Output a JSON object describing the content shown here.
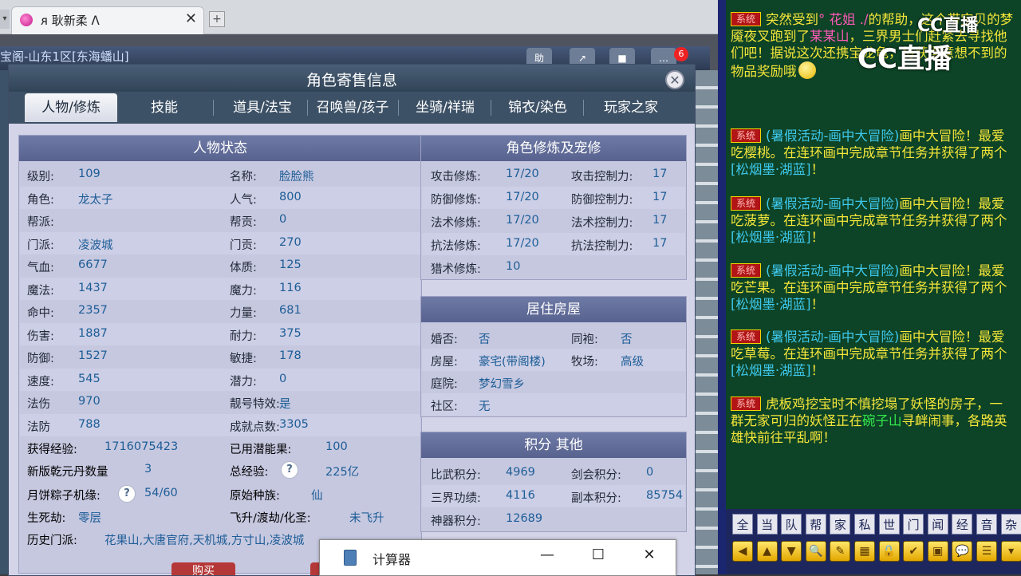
{
  "browser": {
    "tab_title": "ᴙ 耿新柔 ᐱ",
    "new_tab_label": "+",
    "tab_close": "✕",
    "scroll_label": "▾",
    "location": "宝阁-山东1区[东海蟠山]",
    "toolbar": [
      "助",
      "↗",
      "■",
      "…"
    ],
    "badge_count": "6"
  },
  "dialog": {
    "title": "角色寄售信息",
    "close": "✕",
    "tabs": [
      "人物/修炼",
      "技能",
      "道具/法宝",
      "召唤兽/孩子",
      "坐骑/祥瑞",
      "锦衣/染色",
      "玩家之家"
    ],
    "active_tab": 0,
    "status": {
      "heading": "人物状态",
      "rows": [
        [
          {
            "l": "级别:",
            "v": "109"
          },
          {
            "l": "名称:",
            "v": "脸脸熊"
          }
        ],
        [
          {
            "l": "角色:",
            "v": "龙太子"
          },
          {
            "l": "人气:",
            "v": "800"
          }
        ],
        [
          {
            "l": "帮派:",
            "v": ""
          },
          {
            "l": "帮贡:",
            "v": "0"
          }
        ],
        [
          {
            "l": "门派:",
            "v": "凌波城"
          },
          {
            "l": "门贡:",
            "v": "270"
          }
        ],
        [
          {
            "l": "气血:",
            "v": "6677"
          },
          {
            "l": "体质:",
            "v": "125"
          }
        ],
        [
          {
            "l": "魔法:",
            "v": "1437"
          },
          {
            "l": "魔力:",
            "v": "116"
          }
        ],
        [
          {
            "l": "命中:",
            "v": "2357"
          },
          {
            "l": "力量:",
            "v": "681"
          }
        ],
        [
          {
            "l": "伤害:",
            "v": "1887"
          },
          {
            "l": "耐力:",
            "v": "375"
          }
        ],
        [
          {
            "l": "防御:",
            "v": "1527"
          },
          {
            "l": "敏捷:",
            "v": "178"
          }
        ],
        [
          {
            "l": "速度:",
            "v": "545"
          },
          {
            "l": "潜力:",
            "v": "0"
          }
        ],
        [
          {
            "l": "法伤",
            "v": "970"
          },
          {
            "l": "靓号特效:",
            "v": "是"
          }
        ],
        [
          {
            "l": "法防",
            "v": "788"
          },
          {
            "l": "成就点数:",
            "v": "3305"
          }
        ]
      ],
      "exp_label": "获得经验:",
      "exp_value": "1716075423",
      "used_fruit_label": "已用潜能果:",
      "used_fruit_value": "100",
      "qiankun_label": "新版乾元丹数量",
      "qiankun_value": "3",
      "total_exp_label": "总经验:",
      "total_exp_value": "225亿",
      "zongzi_label": "月饼粽子机缘:",
      "zongzi_value": "54/60",
      "race_label": "原始种族:",
      "race_value": "仙",
      "life_label": "生死劫:",
      "life_value": "零层",
      "ascend_label": "飞升/渡劫/化圣:",
      "ascend_value": "未飞升",
      "history_label": "历史门派:",
      "history_value": "花果山,大唐官府,天机城,方寸山,凌波城",
      "help": "?"
    },
    "cultivation": {
      "heading": "角色修炼及宠修",
      "rows": [
        [
          {
            "l": "攻击修炼:",
            "v": "17/20"
          },
          {
            "l": "攻击控制力:",
            "v": "17"
          }
        ],
        [
          {
            "l": "防御修炼:",
            "v": "17/20"
          },
          {
            "l": "防御控制力:",
            "v": "17"
          }
        ],
        [
          {
            "l": "法术修炼:",
            "v": "17/20"
          },
          {
            "l": "法术控制力:",
            "v": "17"
          }
        ],
        [
          {
            "l": "抗法修炼:",
            "v": "17/20"
          },
          {
            "l": "抗法控制力:",
            "v": "17"
          }
        ],
        [
          {
            "l": "猎术修炼:",
            "v": "10"
          }
        ]
      ]
    },
    "house": {
      "heading": "居住房屋",
      "rows": [
        [
          {
            "l": "婚否:",
            "v": "否"
          },
          {
            "l": "同袍:",
            "v": "否"
          }
        ],
        [
          {
            "l": "房屋:",
            "v": "豪宅(带阁楼)"
          },
          {
            "l": "牧场:",
            "v": "高级"
          }
        ],
        [
          {
            "l": "庭院:",
            "v": "梦幻雪乡"
          }
        ],
        [
          {
            "l": "社区:",
            "v": "无"
          }
        ]
      ]
    },
    "points": {
      "heading": "积分 其他",
      "rows": [
        [
          {
            "l": "比武积分:",
            "v": "4969"
          },
          {
            "l": "剑会积分:",
            "v": "0"
          }
        ],
        [
          {
            "l": "三界功绩:",
            "v": "4116"
          },
          {
            "l": "副本积分:",
            "v": "85754"
          }
        ],
        [
          {
            "l": "神器积分:",
            "v": "12689"
          }
        ]
      ]
    },
    "buy_label": "购买"
  },
  "calculator": {
    "title": "计算器",
    "min": "—",
    "max": "☐",
    "close": "✕"
  },
  "chat": {
    "sys_tag": "系统",
    "logo": "CC直播",
    "messages": [
      {
        "parts": [
          {
            "c": "yellow",
            "t": "突然受到"
          },
          {
            "c": "pink",
            "t": "° 花姐 ./"
          },
          {
            "c": "yellow",
            "t": "的帮助，这个带宝贝的梦魇夜叉跑到了"
          },
          {
            "c": "pink",
            "t": "某某山"
          },
          {
            "c": "yellow",
            "t": "，三界男士们赶紧去寻找他们吧！据说这次还携宝龙龟，将获得意想不到的物品奖励哦"
          }
        ]
      },
      {
        "parts": [
          {
            "c": "cyan",
            "t": "(暑假活动-画中大冒险)"
          },
          {
            "c": "yellow",
            "t": "画中大冒险！最爱吃樱桃。在连环画中完成章节任务并获得了两个"
          },
          {
            "c": "cyan",
            "t": "[松烟墨·湖蓝]"
          },
          {
            "c": "yellow",
            "t": "！"
          }
        ]
      },
      {
        "parts": [
          {
            "c": "cyan",
            "t": "(暑假活动-画中大冒险)"
          },
          {
            "c": "yellow",
            "t": "画中大冒险！最爱吃菠萝。在连环画中完成章节任务并获得了两个"
          },
          {
            "c": "cyan",
            "t": "[松烟墨·湖蓝]"
          },
          {
            "c": "yellow",
            "t": "！"
          }
        ]
      },
      {
        "parts": [
          {
            "c": "cyan",
            "t": "(暑假活动-画中大冒险)"
          },
          {
            "c": "yellow",
            "t": "画中大冒险！最爱吃芒果。在连环画中完成章节任务并获得了两个"
          },
          {
            "c": "cyan",
            "t": "[松烟墨·湖蓝]"
          },
          {
            "c": "yellow",
            "t": "！"
          }
        ]
      },
      {
        "parts": [
          {
            "c": "cyan",
            "t": "(暑假活动-画中大冒险)"
          },
          {
            "c": "yellow",
            "t": "画中大冒险！最爱吃草莓。在连环画中完成章节任务并获得了两个"
          },
          {
            "c": "cyan",
            "t": "[松烟墨·湖蓝]"
          },
          {
            "c": "yellow",
            "t": "！"
          }
        ]
      },
      {
        "parts": [
          {
            "c": "yellow",
            "t": "虎板鸡挖宝时不慎挖塌了妖怪的房子，一群无家可归的妖怪正在"
          },
          {
            "c": "green",
            "t": "碗子山"
          },
          {
            "c": "yellow",
            "t": "寻衅闹事，各路英雄快前往平乱啊！"
          }
        ]
      }
    ],
    "channels": [
      "全",
      "当",
      "队",
      "帮",
      "家",
      "私",
      "世",
      "门",
      "闻",
      "经",
      "音",
      "杂"
    ],
    "tools": [
      "◀",
      "▲",
      "▼",
      "🔍",
      "✎",
      "▦",
      "🔒",
      "✔",
      "▣",
      "💬",
      "☰",
      "▾"
    ]
  }
}
